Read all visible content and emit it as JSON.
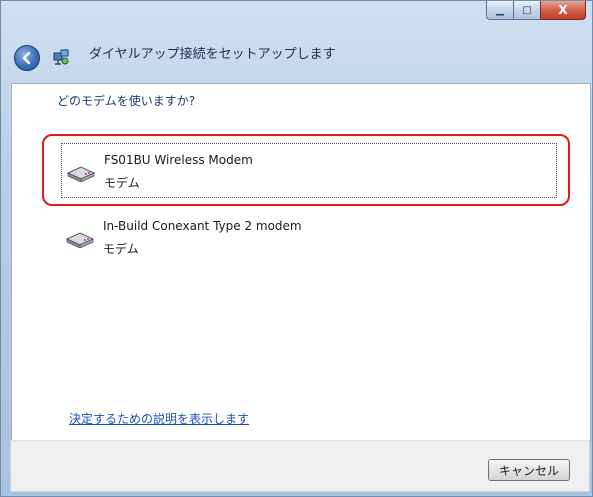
{
  "window": {
    "title": "ダイヤルアップ接続をセットアップします",
    "caption": {
      "minimize": "▁",
      "maximize": "□",
      "close": "X"
    }
  },
  "main": {
    "question": "どのモデムを使いますか?",
    "modems": [
      {
        "name": "FS01BU Wireless Modem",
        "type": "モデム",
        "icon": "modem-icon",
        "selected": true
      },
      {
        "name": "In-Build Conexant Type 2 modem",
        "type": "モデム",
        "icon": "modem-icon",
        "selected": false
      }
    ],
    "help_link": "決定するための説明を表示します"
  },
  "footer": {
    "cancel_label": "キャンセル"
  },
  "colors": {
    "highlight_ring": "#e01a1a",
    "link": "#1a4fbf",
    "question_text": "#1f3a70"
  }
}
